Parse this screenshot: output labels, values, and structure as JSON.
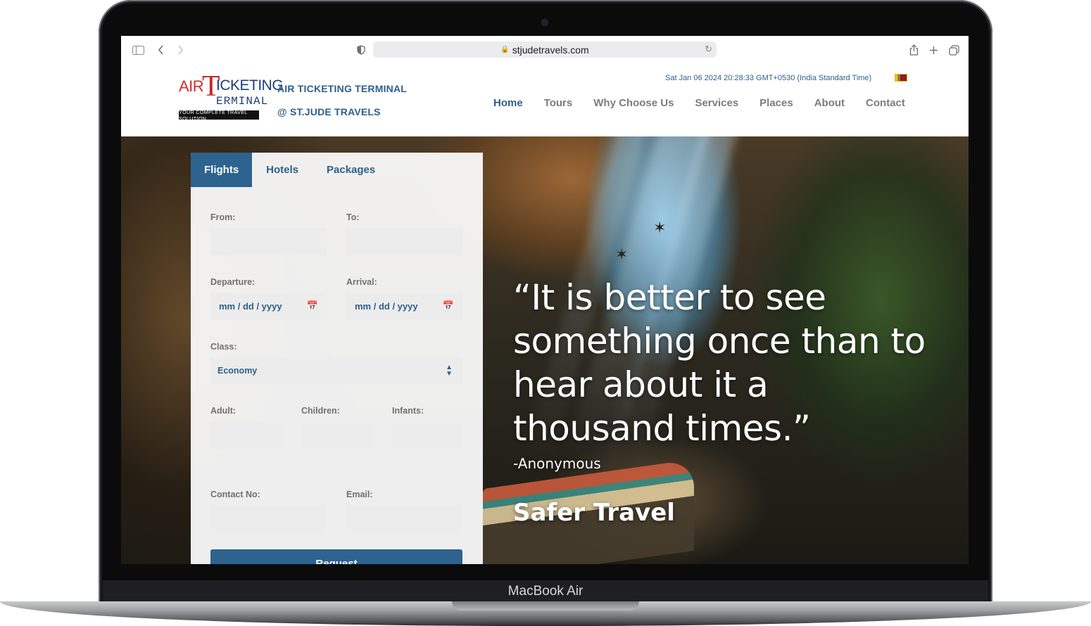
{
  "device": {
    "label": "MacBook Air"
  },
  "browser": {
    "url": "stjudetravels.com",
    "icons": {
      "sidebar": "sidebar-icon",
      "back": "chevron-left-icon",
      "forward": "chevron-right-icon",
      "privacy": "shield-icon",
      "reload": "reload-icon",
      "share": "share-icon",
      "new_tab": "plus-icon",
      "tabs": "tabs-icon"
    }
  },
  "header": {
    "logo": {
      "air": "AIR",
      "t": "T",
      "icketing": "ICKETING",
      "erminal": "ERMINAL",
      "tagline": "YOUR COMPLETE TRAVEL SOLUTION"
    },
    "brand_line1": "AIR TICKETING TERMINAL",
    "brand_line2": "@ ST.JUDE TRAVELS",
    "datetime": "Sat Jan 06 2024 20:28:33 GMT+0530 (India Standard Time)",
    "flag": "sri-lanka-flag-icon",
    "nav": [
      "Home",
      "Tours",
      "Why Choose Us",
      "Services",
      "Places",
      "About",
      "Contact"
    ],
    "active_nav": "Home"
  },
  "booking": {
    "tabs": [
      "Flights",
      "Hotels",
      "Packages"
    ],
    "active_tab": "Flights",
    "from_label": "From:",
    "to_label": "To:",
    "departure_label": "Departure:",
    "arrival_label": "Arrival:",
    "date_placeholder": "mm / dd / yyyy",
    "class_label": "Class:",
    "class_value": "Economy",
    "adult_label": "Adult:",
    "children_label": "Children:",
    "infants_label": "Infants:",
    "contact_label": "Contact No:",
    "email_label": "Email:",
    "button": "Request"
  },
  "hero": {
    "quote": "“It is better to see something once than to hear about it a thousand times.”",
    "author": "-Anonymous",
    "tagline": "Safer Travel"
  },
  "colors": {
    "primary": "#2e6390",
    "brand_text": "#2e5f8c",
    "nav_inactive": "#7c7c80",
    "logo_red": "#d52b2b",
    "logo_blue": "#1f3d7a"
  }
}
